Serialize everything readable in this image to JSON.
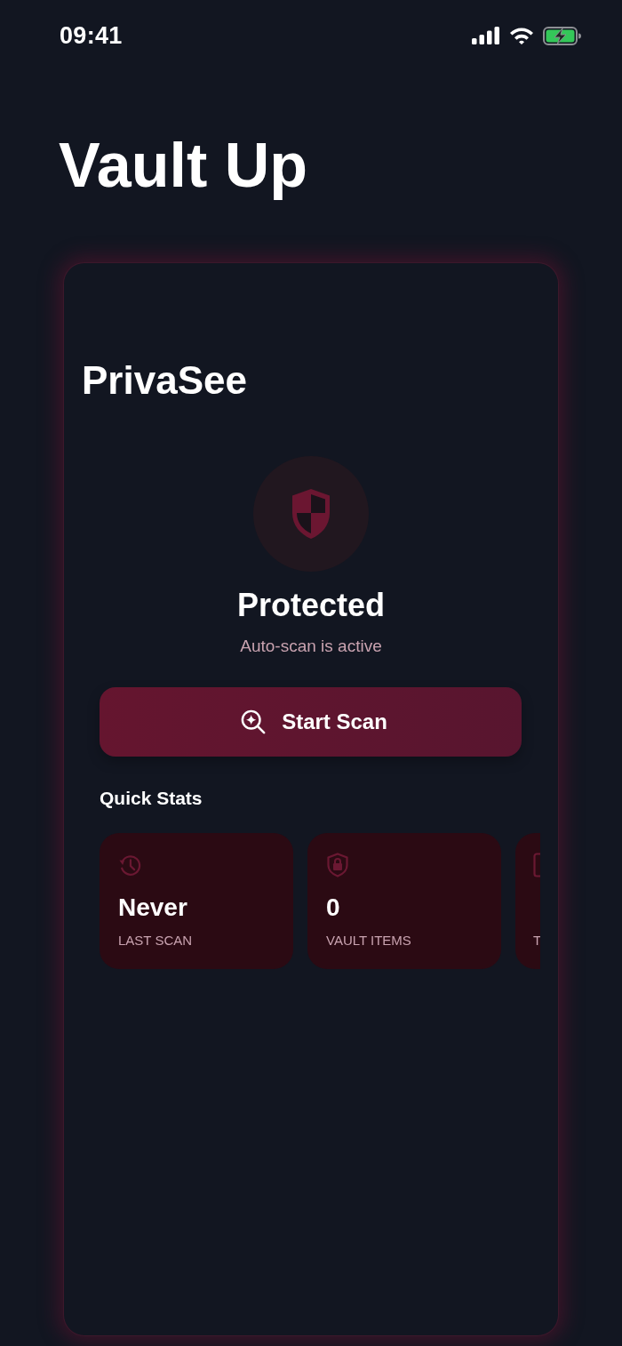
{
  "status_bar": {
    "time": "09:41"
  },
  "app": {
    "title": "Vault Up"
  },
  "card": {
    "title": "PrivaSee",
    "status_label": "Protected",
    "status_detail": "Auto-scan is active",
    "scan_button": {
      "label": "Start Scan"
    },
    "quick_stats": {
      "heading": "Quick Stats",
      "items": [
        {
          "value": "Never",
          "label": "LAST SCAN"
        },
        {
          "value": "0",
          "label": "VAULT ITEMS"
        },
        {
          "label": "T"
        }
      ]
    }
  }
}
